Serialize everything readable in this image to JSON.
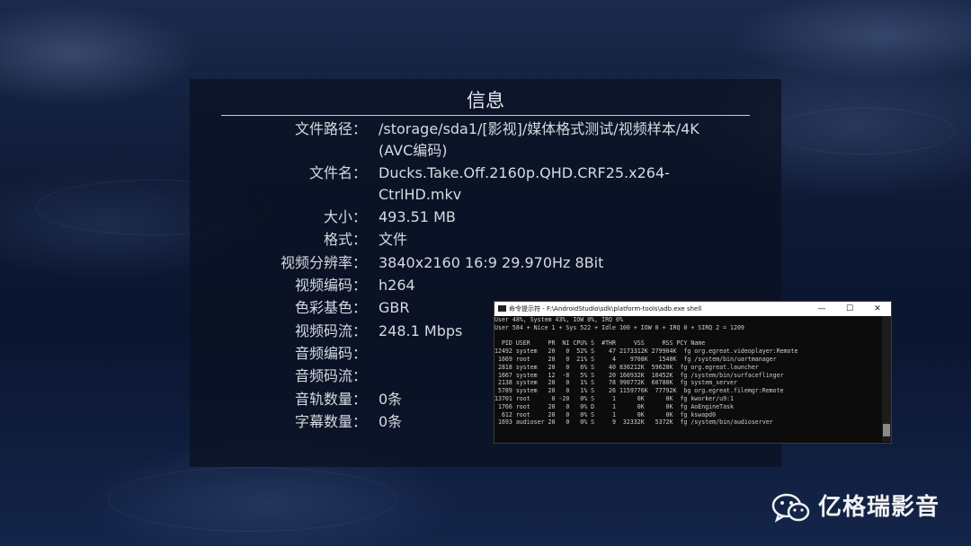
{
  "info": {
    "title": "信息",
    "rows": [
      {
        "label": "文件路径：",
        "value": "/storage/sda1/[影视]/媒体格式测试/视频样本/4K (AVC编码)"
      },
      {
        "label": "文件名：",
        "value": "Ducks.Take.Off.2160p.QHD.CRF25.x264-CtrlHD.mkv"
      },
      {
        "label": "大小：",
        "value": "493.51 MB"
      },
      {
        "label": "格式：",
        "value": "文件"
      },
      {
        "label": "视频分辨率：",
        "value": "3840x2160 16:9 29.970Hz 8Bit"
      },
      {
        "label": "视频编码：",
        "value": "h264"
      },
      {
        "label": "色彩基色：",
        "value": "GBR"
      },
      {
        "label": "视频码流：",
        "value": "248.1 Mbps"
      },
      {
        "label": "音频编码：",
        "value": ""
      },
      {
        "label": "音频码流：",
        "value": ""
      },
      {
        "label": "音轨数量：",
        "value": "0条"
      },
      {
        "label": "字幕数量：",
        "value": "0条"
      }
    ]
  },
  "terminal": {
    "title": "命令提示符 - F:\\AndroidStudio\\sdk\\platform-tools\\adb.exe  shell",
    "minimize": "—",
    "maximize": "☐",
    "close": "✕",
    "lines": [
      "User 48%, System 43%, IOW 0%, IRQ 0%",
      "User 584 + Nice 1 + Sys 522 + Idle 100 + IOW 0 + IRQ 0 + SIRQ 2 = 1209",
      "",
      "  PID USER     PR  NI CPU% S  #THR     VSS     RSS PCY Name",
      "12492 system   20   0  52% S    47 2173312K 279904K  fg org.egreat.videoplayer:Remote",
      " 1669 root     20   0  21% S     4    9708K   1540K  fg /system/bin/uartmanager",
      " 2818 system   20   0   6% S    40 836212K  59628K  fg org.egreat.launcher",
      " 1667 system   12  -8   5% S    20 160932K  10452K  fg /system/bin/surfaceflinger",
      " 2138 system   20   0   1% S    78 990772K  60780K  fg system_server",
      " 5789 system   20   0   1% S    26 1159776K  77792K  bg org.egreat.filemgr:Remote",
      "13701 root      0 -20   0% S     1      0K      0K  fg kworker/u9:1",
      " 1766 root     20   0   0% D     1      0K      0K  fg AoEngineTask",
      "  612 root     20   0   0% S     1      0K      0K  fg kswapd0",
      " 1693 audioser 20   0   0% S     9  32332K   5372K  fg /system/bin/audioserver"
    ]
  },
  "watermark": {
    "icon": "wechat-icon",
    "text": "亿格瑞影音"
  }
}
